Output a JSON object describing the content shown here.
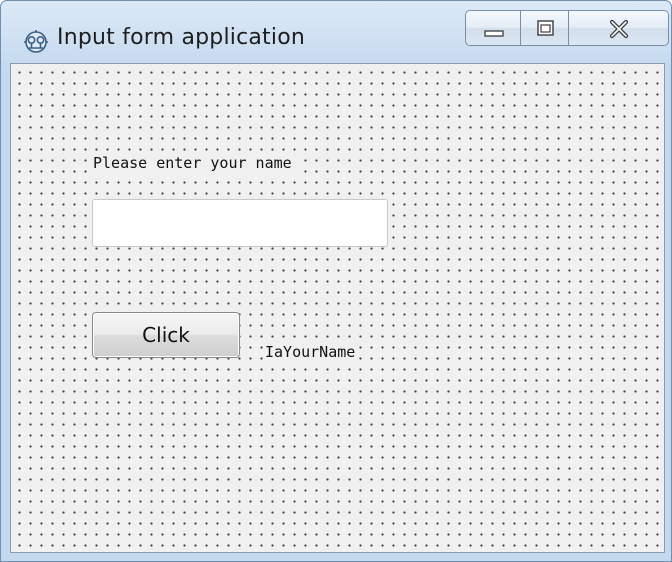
{
  "window": {
    "title": "Input form application",
    "icon": "app-icon",
    "caption_buttons": [
      "minimize-icon",
      "maximize-icon",
      "close-icon"
    ]
  },
  "form": {
    "prompt_label": "Please enter your name",
    "name_input_value": "",
    "button_label": "Click",
    "output_label": "IaYourName"
  },
  "colors": {
    "frame": "#c4d8ee",
    "client_background": "#f0f0f0",
    "grid_dots": "#3b3b3b"
  }
}
